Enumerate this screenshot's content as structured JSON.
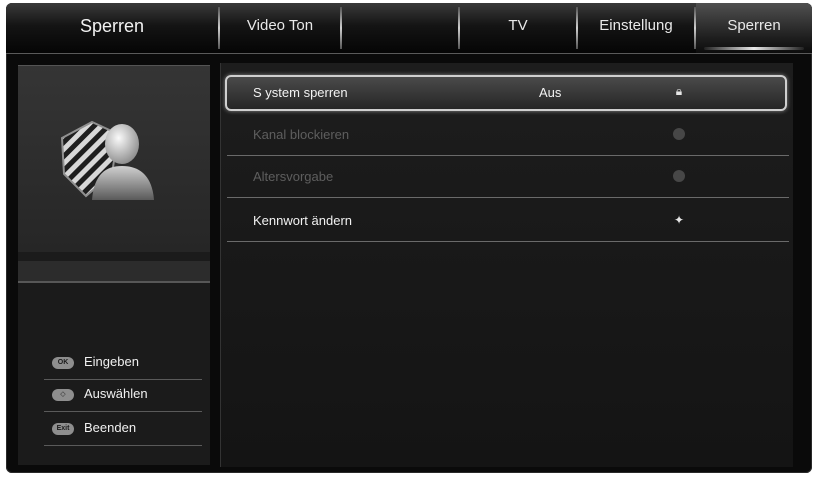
{
  "header": {
    "page_title": "Sperren",
    "tabs": [
      {
        "label": "Video Ton"
      },
      {
        "label": ""
      },
      {
        "label": "TV"
      },
      {
        "label": "Einstellung"
      },
      {
        "label": "Sperren"
      }
    ]
  },
  "sidebar": {
    "avatar_icon": "user-lock-icon",
    "hints": [
      {
        "key": "OK",
        "label": "Eingeben"
      },
      {
        "key": "◇",
        "label": "Auswählen"
      },
      {
        "key": "Exit",
        "label": "Beenden"
      }
    ]
  },
  "menu": {
    "items": [
      {
        "label": "S ystem sperren",
        "value": "Aus",
        "icon": "lock-icon",
        "state": "selected"
      },
      {
        "label": "Kanal blockieren",
        "icon": "dot-icon",
        "state": "disabled"
      },
      {
        "label": "Altersvorgabe",
        "icon": "dot-icon",
        "state": "disabled"
      },
      {
        "label": "Kennwort ändern",
        "icon": "key-icon",
        "state": "enabled"
      }
    ]
  }
}
